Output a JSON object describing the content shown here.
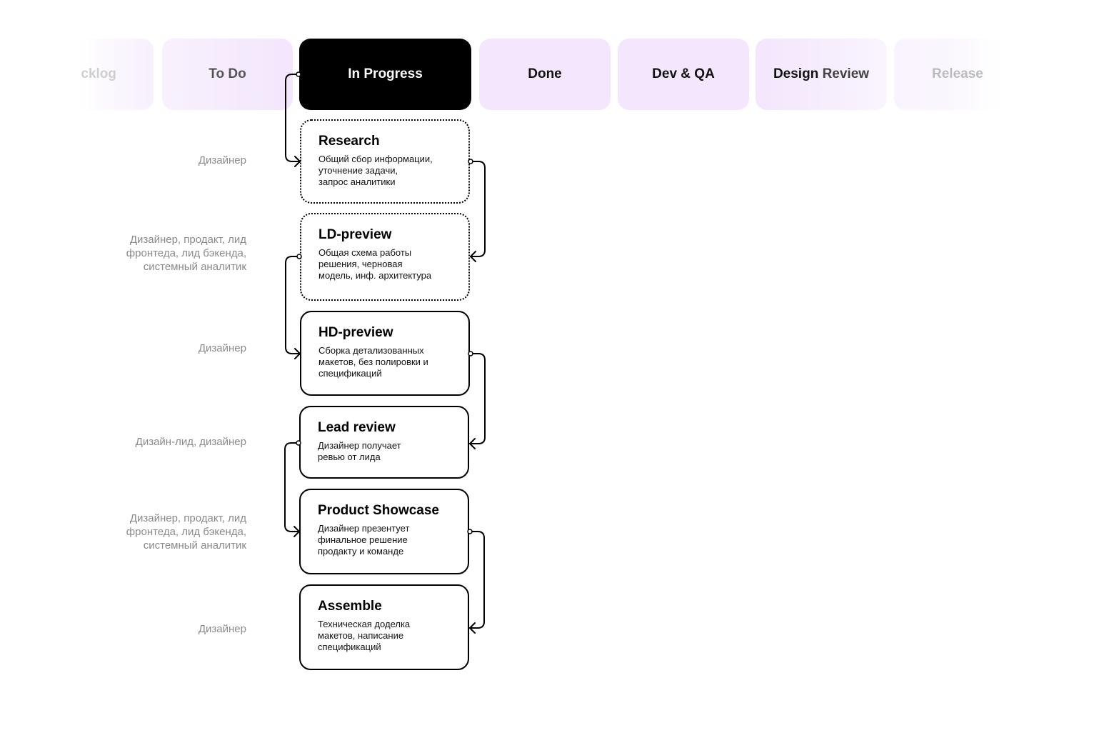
{
  "columns": [
    {
      "id": "backlog",
      "label": "cklog",
      "state": "faded"
    },
    {
      "id": "todo",
      "label": "To Do",
      "state": "normal"
    },
    {
      "id": "inprogress",
      "label": "In Progress",
      "state": "active"
    },
    {
      "id": "done",
      "label": "Done",
      "state": "normal"
    },
    {
      "id": "devqa",
      "label": "Dev & QA",
      "state": "normal"
    },
    {
      "id": "designreview",
      "label_part1": "Design ",
      "label_part2": "Review",
      "state": "normal"
    },
    {
      "id": "release",
      "label": "Release",
      "state": "faded"
    }
  ],
  "stages": [
    {
      "title": "Research",
      "description": "Общий сбор информации,\nуточнение задачи,\nзапрос аналитики",
      "style": "dotted",
      "role": "Дизайнер"
    },
    {
      "title": "LD-preview",
      "description": "Общая схема работы\nрешения, черновая\nмодель, инф. архитектура",
      "style": "dotted",
      "role": "Дизайнер, продакт, лид\nфронтеда, лид бэкенда,\nсистемный аналитик"
    },
    {
      "title": "HD-preview",
      "description": "Сборка детализованных\nмакетов, без полировки и\nспецификаций",
      "style": "solid",
      "role": "Дизайнер"
    },
    {
      "title": "Lead review",
      "description": "Дизайнер получает\nревью от лида",
      "style": "solid",
      "role": "Дизайн-лид, дизайнер"
    },
    {
      "title": "Product Showcase",
      "description": "Дизайнер презентует\nфинальное решение\nпродакту и команде",
      "style": "solid",
      "role": "Дизайнер, продакт, лид\nфронтеда, лид бэкенда,\nсистемный аналитик"
    },
    {
      "title": "Assemble",
      "description": "Техническая доделка\nмакетов, написание\nспецификаций",
      "style": "solid",
      "role": "Дизайнер"
    }
  ],
  "colors": {
    "column_bg": "#f4e7fd",
    "active_bg": "#000000",
    "active_text": "#ffffff",
    "role_text": "#8a8a8a"
  }
}
